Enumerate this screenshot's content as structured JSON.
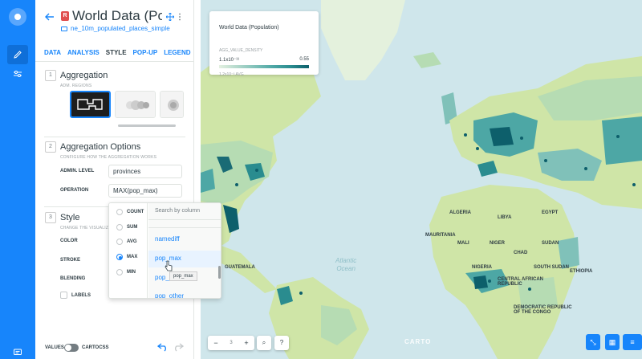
{
  "header": {
    "title": "World Data (Population)",
    "badge": "R",
    "dataset": "ne_10m_populated_places_simple"
  },
  "tabs": [
    {
      "label": "DATA",
      "active": false
    },
    {
      "label": "ANALYSIS",
      "active": false
    },
    {
      "label": "STYLE",
      "active": true
    },
    {
      "label": "POP-UP",
      "active": false
    },
    {
      "label": "LEGEND",
      "active": false
    }
  ],
  "sections": {
    "aggregation": {
      "num": "1",
      "title": "Aggregation",
      "sub": "ADM. REGIONS"
    },
    "options": {
      "num": "2",
      "title": "Aggregation Options",
      "sub": "CONFIGURE HOW THE AGGREGATION WORKS",
      "admin_level_label": "ADMIN. LEVEL",
      "admin_level_value": "provinces",
      "operation_label": "OPERATION",
      "operation_value": "MAX(pop_max)"
    },
    "style": {
      "num": "3",
      "title": "Style",
      "sub": "CHANGE THE VISUALIZ",
      "color_label": "COLOR",
      "stroke_label": "STROKE",
      "blending_label": "BLENDING",
      "labels_label": "LABELS"
    }
  },
  "popup": {
    "operations": [
      {
        "label": "COUNT",
        "selected": false
      },
      {
        "label": "SUM",
        "selected": false
      },
      {
        "label": "AVG",
        "selected": false
      },
      {
        "label": "MAX",
        "selected": true
      },
      {
        "label": "MIN",
        "selected": false
      }
    ],
    "search_placeholder": "Search by column",
    "columns": [
      "namediff",
      "pop_max",
      "pop_min",
      "pop_other"
    ],
    "tooltip": "pop_max"
  },
  "footer": {
    "values_label": "VALUES",
    "cartocss_label": "CARTOCSS"
  },
  "legend": {
    "title": "World Data (Population)",
    "sub": "AGG_VALUE_DENSITY",
    "min": "1.1x10⁻¹¹",
    "max": "0.55",
    "avg": "1.2x10⁻³ AVG"
  },
  "map": {
    "ocean_label_1": "Atlantic",
    "ocean_label_2": "Ocean",
    "attribution": "CARTO",
    "zoom_level": "3",
    "places": [
      "ALGERIA",
      "LIBYA",
      "EGYPT",
      "MAURITANIA",
      "MALI",
      "NIGER",
      "SUDAN",
      "CHAD",
      "NIGERIA",
      "ETHIOPIA",
      "CENTRAL AFRICAN REPUBLIC",
      "DEMOCRATIC REPUBLIC OF THE CONGO",
      "GUATEMALA",
      "SOUTH SUDAN"
    ]
  },
  "colors": {
    "accent": "#1785fb",
    "water": "#cfe6eb",
    "land": "#cfe5a7",
    "choropleth_dark": "#0d5f6b"
  }
}
